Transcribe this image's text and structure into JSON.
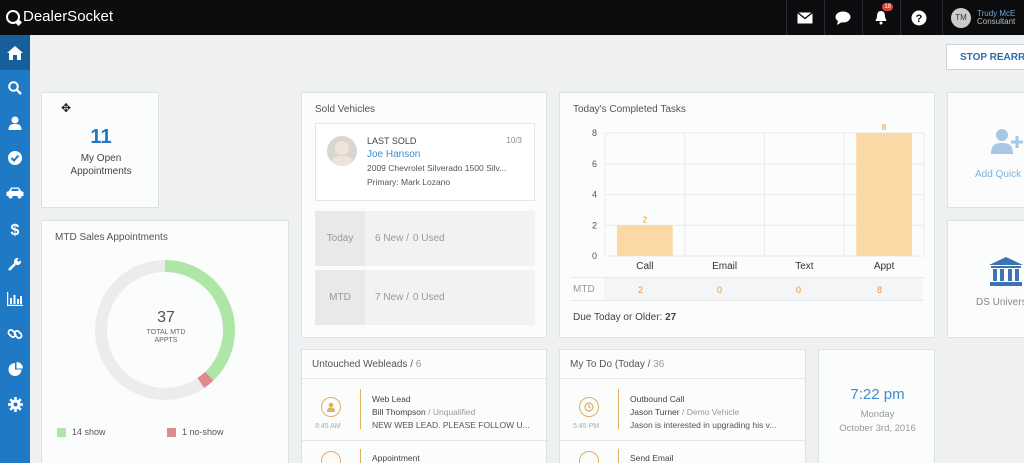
{
  "app": {
    "brand": "DealerSocket"
  },
  "topbar": {
    "icons": [
      "mail-icon",
      "chat-icon",
      "bell-icon",
      "help-icon"
    ],
    "notification_count": "18",
    "user_initials": "TM",
    "user_name": "Trudy McE",
    "user_role": "Consultant"
  },
  "sidebar": {
    "items": [
      "home-icon",
      "search-icon",
      "user-icon",
      "check-icon",
      "car-icon",
      "dollar-icon",
      "wrench-icon",
      "bar-chart-icon",
      "link-icon",
      "pie-chart-icon",
      "gear-icon"
    ]
  },
  "toolbar": {
    "stop_label": "STOP REARRA"
  },
  "open_appts": {
    "count": "11",
    "label_line1": "My Open",
    "label_line2": "Appointments"
  },
  "mtd_sales": {
    "title": "MTD Sales Appointments",
    "total": "37",
    "total_label_line1": "TOTAL MTD",
    "total_label_line2": "APPTS",
    "show_label": "14 show",
    "noshow_label": "1 no-show",
    "show": 14,
    "noshow": 1,
    "total_value": 37,
    "colors": {
      "show": "#aee6a8",
      "noshow": "#e08a8f",
      "rest": "#ececec"
    }
  },
  "sold_vehicles": {
    "title": "Sold Vehicles",
    "last_sold_label": "LAST SOLD",
    "date": "10/3",
    "customer": "Joe Hanson",
    "vehicle": "2009 Chevrolet Silverado 1500 Silv...",
    "primary": "Primary: Mark Lozano",
    "today_label": "Today",
    "today_new": "6 New /",
    "today_used": "0 Used",
    "mtd_label": "MTD",
    "mtd_new": "7 New /",
    "mtd_used": "0 Used"
  },
  "tasks": {
    "title": "Today's Completed Tasks",
    "mtd_label": "MTD",
    "mtd_values": [
      "2",
      "0",
      "0",
      "8"
    ],
    "due_label": "Due Today or Older:",
    "due_count": "27"
  },
  "chart_data": {
    "type": "bar",
    "title": "Today's Completed Tasks",
    "categories": [
      "Call",
      "Email",
      "Text",
      "Appt"
    ],
    "values": [
      2,
      0,
      0,
      8
    ],
    "data_labels": [
      "2",
      "",
      "",
      "8"
    ],
    "ylim": [
      0,
      8
    ],
    "yticks": [
      0,
      2,
      4,
      6,
      8
    ],
    "xlabel": "",
    "ylabel": "",
    "grid": true,
    "bar_color": "#fbd9a6",
    "label_color": "#e8962e"
  },
  "quick_add": {
    "label": "Add Quick"
  },
  "ds_univ": {
    "label": "DS Univers"
  },
  "webleads": {
    "title": "Untouched Webleads /",
    "count": "6",
    "rows": [
      {
        "time": "8:45 AM",
        "type": "Web Lead",
        "name": "Bill Thompson",
        "status": "Unqualified",
        "note": "NEW WEB LEAD. PLEASE FOLLOW U..."
      },
      {
        "type": "Appointment"
      }
    ]
  },
  "todo": {
    "title": "My To Do (Today /",
    "count": "36",
    "rows": [
      {
        "time": "5:45 PM",
        "type": "Outbound Call",
        "name": "Jason Turner",
        "status": "Demo Vehicle",
        "note": "Jason is interested in upgrading his v..."
      },
      {
        "type": "Send Email"
      }
    ]
  },
  "clock": {
    "time": "7:22 pm",
    "day": "Monday",
    "date": "October 3rd, 2016"
  }
}
